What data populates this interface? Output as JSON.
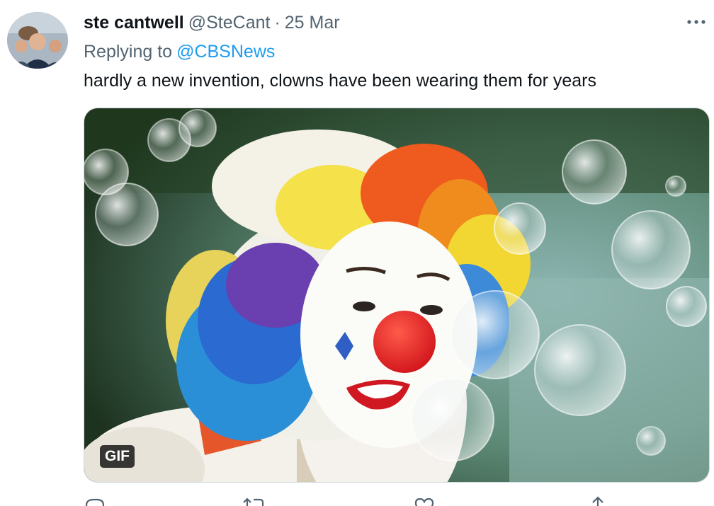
{
  "tweet": {
    "display_name": "ste cantwell",
    "handle": "@SteCant",
    "separator": "·",
    "timestamp": "25 Mar",
    "replying_prefix": "Replying to",
    "replying_to": "@CBSNews",
    "text": "hardly a new invention, clowns have been wearing them for years",
    "media": {
      "badge": "GIF"
    }
  },
  "icons": {
    "more": "more-horizontal-icon",
    "reply": "reply-icon",
    "retweet": "retweet-icon",
    "like": "heart-icon",
    "share": "share-icon"
  },
  "colors": {
    "link": "#1d9bf0",
    "secondary_text": "#536471",
    "primary_text": "#0f1419"
  }
}
